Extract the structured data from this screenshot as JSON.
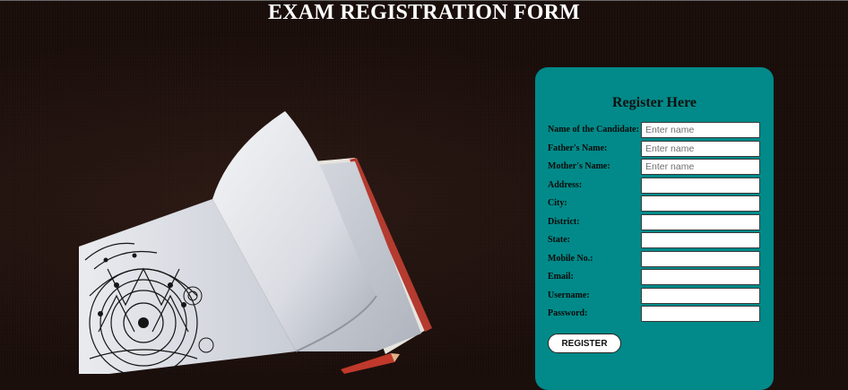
{
  "page": {
    "title": "EXAM REGISTRATION FORM"
  },
  "form": {
    "heading": "Register Here",
    "fields": [
      {
        "label": "Name of the Candidate:",
        "placeholder": "Enter name",
        "value": ""
      },
      {
        "label": "Father's Name:",
        "placeholder": "Enter name",
        "value": ""
      },
      {
        "label": "Mother's Name:",
        "placeholder": "Enter name",
        "value": ""
      },
      {
        "label": "Address:",
        "placeholder": "",
        "value": ""
      },
      {
        "label": "City:",
        "placeholder": "",
        "value": ""
      },
      {
        "label": "District:",
        "placeholder": "",
        "value": ""
      },
      {
        "label": "State:",
        "placeholder": "",
        "value": ""
      },
      {
        "label": "Mobile No.:",
        "placeholder": "",
        "value": ""
      },
      {
        "label": "Email:",
        "placeholder": "",
        "value": ""
      },
      {
        "label": "Username:",
        "placeholder": "",
        "value": ""
      },
      {
        "label": "Password:",
        "placeholder": "",
        "value": ""
      }
    ],
    "submit_label": "REGISTER"
  },
  "colors": {
    "background": "#1a0e0b",
    "card": "#018a89",
    "title_text": "#ffffff"
  }
}
